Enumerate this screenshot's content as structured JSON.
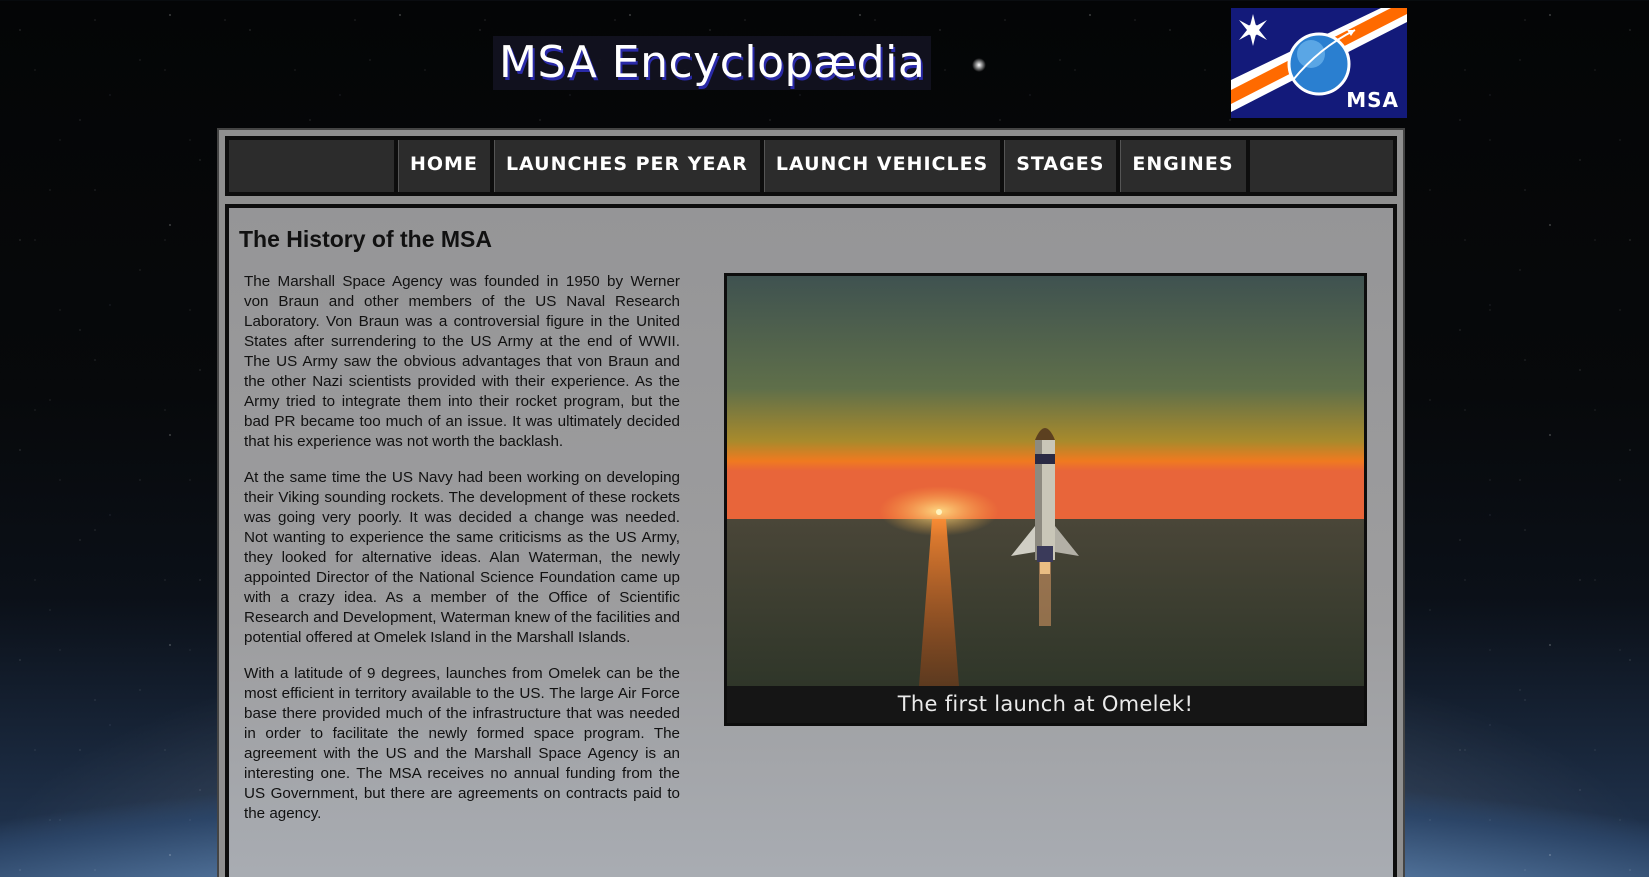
{
  "header": {
    "site_title": "MSA Encyclopædia",
    "logo_text": "MSA"
  },
  "nav": {
    "items": [
      {
        "label": "HOME"
      },
      {
        "label": "LAUNCHES PER YEAR"
      },
      {
        "label": "LAUNCH VEHICLES"
      },
      {
        "label": "STAGES"
      },
      {
        "label": "ENGINES"
      }
    ]
  },
  "main": {
    "heading": "The History of the MSA",
    "paragraphs": [
      "The Marshall Space Agency was founded in 1950 by Werner von Braun and other members of the US Naval Research Laboratory. Von Braun was a controversial figure in the United States after surrendering to the US Army at the end of WWII. The US Army saw the obvious advantages that von Braun and the other Nazi scientists provided with their experience. As the Army tried to integrate them into their rocket program, but the bad PR became too much of an issue. It was ultimately decided that his experience was not worth the backlash.",
      "At the same time the US Navy had been working on developing their Viking sounding rockets. The development of these rockets was going very poorly. It was decided a change was needed. Not wanting to experience the same criticisms as the US Army, they looked for alternative ideas. Alan Waterman, the newly appointed Director of the National Science Foundation came up with a crazy idea. As a member of the Office of Scientific Research and Development, Waterman knew of the facilities and potential offered at Omelek Island in the Marshall Islands.",
      "With a latitude of 9 degrees, launches from Omelek can be the most efficient in territory available to the US. The large Air Force base there provided much of the infrastructure that was needed in order to facilitate the newly formed space program. The agreement with the US and the Marshall Space Agency is an interesting one. The MSA receives no annual funding from the US Government, but there are agreements on contracts paid to the agency."
    ],
    "figure": {
      "caption": "The first launch at Omelek!"
    }
  },
  "colors": {
    "nav_bg": "#2c2c2c",
    "frame_border": "#0d0d0d",
    "logo_blue": "#131a7a",
    "logo_orange": "#ff6a00",
    "title_shadow": "#2a2aa8"
  }
}
